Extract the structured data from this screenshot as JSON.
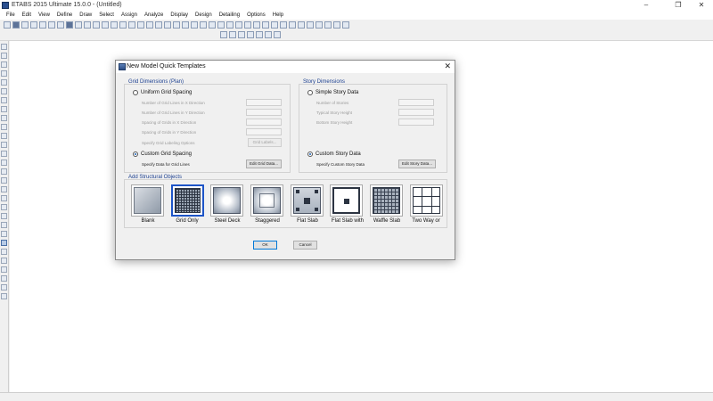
{
  "window": {
    "title": "ETABS 2015 Ultimate 15.0.0 - (Untitled)",
    "minimize": "–",
    "maximize": "❐",
    "close": "✕"
  },
  "menu": [
    "File",
    "Edit",
    "View",
    "Define",
    "Draw",
    "Select",
    "Assign",
    "Analyze",
    "Display",
    "Design",
    "Detailing",
    "Options",
    "Help"
  ],
  "dialog": {
    "title": "New Model Quick Templates",
    "close": "✕",
    "grid": {
      "title": "Grid Dimensions (Plan)",
      "uniform_label": "Uniform Grid Spacing",
      "fields": [
        "Number of Grid Lines in X Direction",
        "Number of Grid Lines in Y Direction",
        "Spacing of Grids in X Direction",
        "Spacing of Grids in Y Direction",
        "Specify Grid Labeling Options"
      ],
      "grid_labels_button": "Grid Labels...",
      "custom_label": "Custom Grid Spacing",
      "custom_note": "Specify Data for Grid Lines",
      "edit_button": "Edit Grid Data..."
    },
    "story": {
      "title": "Story Dimensions",
      "simple_label": "Simple Story Data",
      "fields": [
        "Number of Stories",
        "Typical Story Height",
        "Bottom Story Height"
      ],
      "custom_label": "Custom Story Data",
      "custom_note": "Specify Custom Story Data",
      "edit_button": "Edit Story Data..."
    },
    "objects": {
      "title": "Add Structural Objects",
      "tiles": [
        "Blank",
        "Grid Only",
        "Steel Deck",
        "Staggered",
        "Flat Slab",
        "Flat Slab with",
        "Waffle Slab",
        "Two Way or"
      ]
    },
    "ok": "OK",
    "cancel": "Cancel"
  },
  "colors": {
    "accent": "#1d54c7",
    "group_title": "#1b3f8f"
  }
}
